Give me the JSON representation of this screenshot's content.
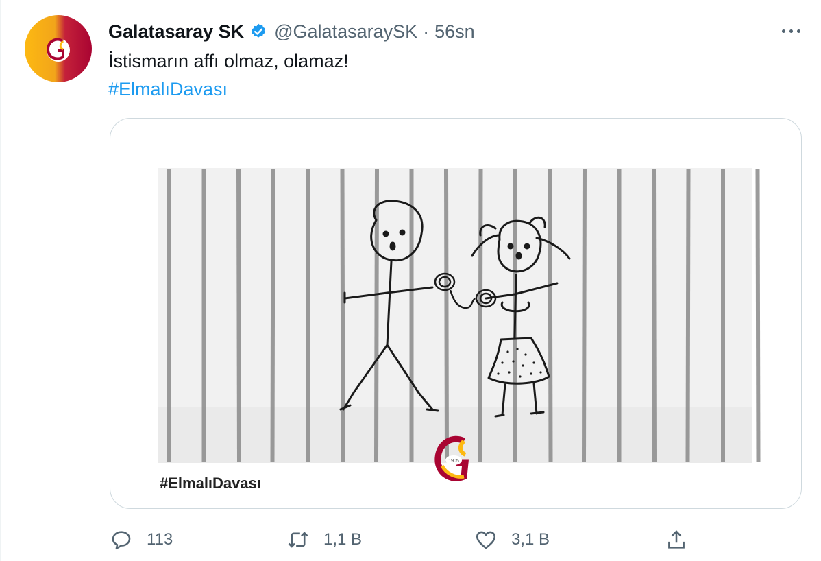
{
  "tweet": {
    "author_name": "Galatasaray SK",
    "handle": "@GalatasaraySK",
    "separator": "·",
    "time": "56sn",
    "text": "İstismarın affı olmaz, olamaz!",
    "hashtag": "#ElmalıDavası"
  },
  "media": {
    "caption": "#ElmalıDavası",
    "logo_year": "1905"
  },
  "actions": {
    "reply_count": "113",
    "retweet_count": "1,1 B",
    "like_count": "3,1 B"
  },
  "colors": {
    "link": "#1d9bf0",
    "muted": "#536471",
    "brand_red": "#a90432",
    "brand_yellow": "#fdb912"
  },
  "icons": [
    "verified-badge-icon",
    "more-options-icon",
    "reply-icon",
    "retweet-icon",
    "like-icon",
    "share-icon"
  ]
}
